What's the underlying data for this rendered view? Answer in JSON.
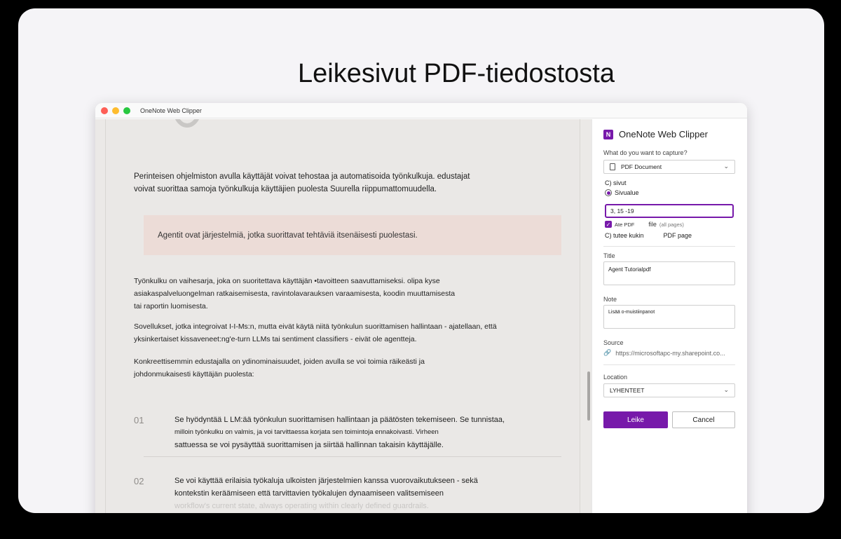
{
  "headline": "Leikesivut PDF-tiedostosta",
  "window": {
    "title": "OneNote Web Clipper"
  },
  "document": {
    "para1_line1": "Perinteisen ohjelmiston avulla käyttäjät voivat tehostaa ja automatisoida työnkulkuja. edustajat",
    "para1_line2": "voivat suorittaa samoja työnkulkuja käyttäjien puolesta Suurella riippumattomuudella.",
    "callout": "Agentit ovat järjestelmiä, jotka suorittavat tehtäviä itsenäisesti puolestasi.",
    "para2_line1": "Työnkulku on vaihesarja, joka on suoritettava käyttäjän •tavoitteen saavuttamiseksi. olipa kyse",
    "para2_line2": "asiakaspalveluongelman ratkaisemisesta, ravintolavarauksen varaamisesta, koodin muuttamisesta",
    "para2_line3": "tai raportin luomisesta.",
    "para3_line1": "Sovellukset, jotka integroivat I-I-Ms:n, mutta eivät käytä niitä työnkulun suorittamisen hallintaan - ajatellaan, että",
    "para3_line2": "yksinkertaiset kissaveneet:ng'e-turn LLMs tai sentiment classifiers - eivät ole agentteja.",
    "para4_line1": "Konkreettisemmin edustajalla on ydinominaisuudet, joiden avulla se voi toimia räikeästi ja",
    "para4_line2": "johdonmukaisesti käyttäjän puolesta:",
    "items": [
      {
        "num": "01",
        "line1": "Se hyödyntää L LM:ää työnkulun suorittamisen hallintaan ja päätösten tekemiseen. Se tunnistaa,",
        "line2": "milloin työnkulku on valmis, ja voi tarvittaessa korjata sen toimintoja ennakoivasti. Virheen",
        "line3": "sattuessa se voi pysäyttää suorittamisen ja siirtää hallinnan takaisin käyttäjälle."
      },
      {
        "num": "02",
        "line1": "Se voi käyttää erilaisia työkaluja ulkoisten järjestelmien kanssa vuorovaikutukseen - sekä",
        "line2": "kontekstin keräämiseen että tarvittavien työkalujen dynaamiseen valitsemiseen",
        "line3": "workflow's current state, always operating within clearly defined guardrails."
      }
    ]
  },
  "clipper": {
    "brand": "OneNote Web Clipper",
    "capture_label": "What do you want to capture?",
    "capture_value": "PDF Document",
    "option_pages": "C) sivut",
    "option_range": "Sivualue",
    "range_value": "3, 15 -19",
    "attach_label": "Ate PDF",
    "attach_file": "file",
    "attach_note": "(all pages)",
    "option_each": "C) tutee kukin",
    "option_each_suffix": "PDF page",
    "title_label": "Title",
    "title_value": "Agent Tutorialpdf",
    "note_label": "Note",
    "note_value": "Lisää o-muistiinpanot",
    "source_label": "Source",
    "source_value": "https://microsoftapc-my.sharepoint.co...",
    "location_label": "Location",
    "location_value": "LYHENTEET",
    "clip_button": "Leike",
    "cancel_button": "Cancel"
  },
  "colors": {
    "accent": "#7719aa",
    "callout_bg": "#ecdcd7"
  },
  "icons": [
    "onenote-icon",
    "pdf-document-icon",
    "chevron-down-icon",
    "link-icon",
    "checkbox-checked-icon"
  ]
}
